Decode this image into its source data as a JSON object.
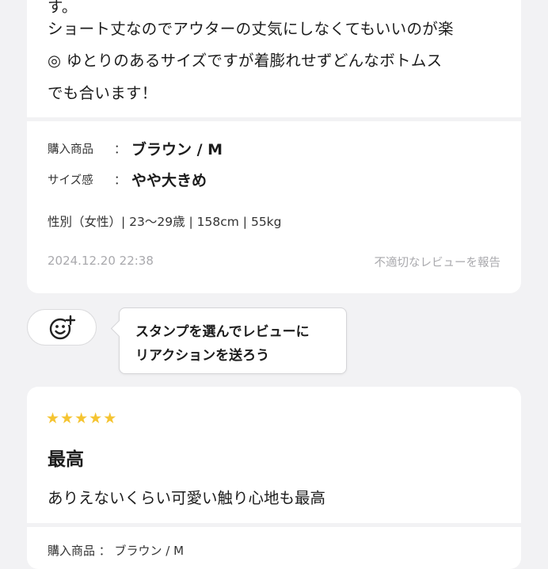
{
  "review1": {
    "body_lines": [
      "す。",
      "ショート丈なのでアウターの丈気にしなくてもいいのが楽",
      "◎ ゆとりのあるサイズですが着膨れせずどんなボトムス",
      "でも合います！"
    ],
    "attributes": [
      {
        "label": "購入商品",
        "colon": "：",
        "value": "ブラウン / M"
      },
      {
        "label": "サイズ感",
        "colon": "：",
        "value": "やや大きめ"
      }
    ],
    "profile": "性別（女性）| 23～29歳 | 158cm | 55kg",
    "date": "2024.12.20 22:38",
    "report_link": "不適切なレビューを報告"
  },
  "stamp": {
    "icon": "smiley-plus-icon",
    "tooltip_lines": [
      "スタンプを選んでレビューに",
      "リアクションを送ろう"
    ]
  },
  "review2": {
    "rating": 5,
    "stars": [
      "★",
      "★",
      "★",
      "★",
      "★"
    ],
    "title": "最高",
    "body": "ありえないくらい可愛い触り心地も最高",
    "cut_attribute": "購入商品 ： ブラウン / M"
  },
  "colors": {
    "background": "#f2f2f4",
    "card": "#ffffff",
    "star": "#f5c431",
    "muted_text": "#a9a9ad"
  }
}
